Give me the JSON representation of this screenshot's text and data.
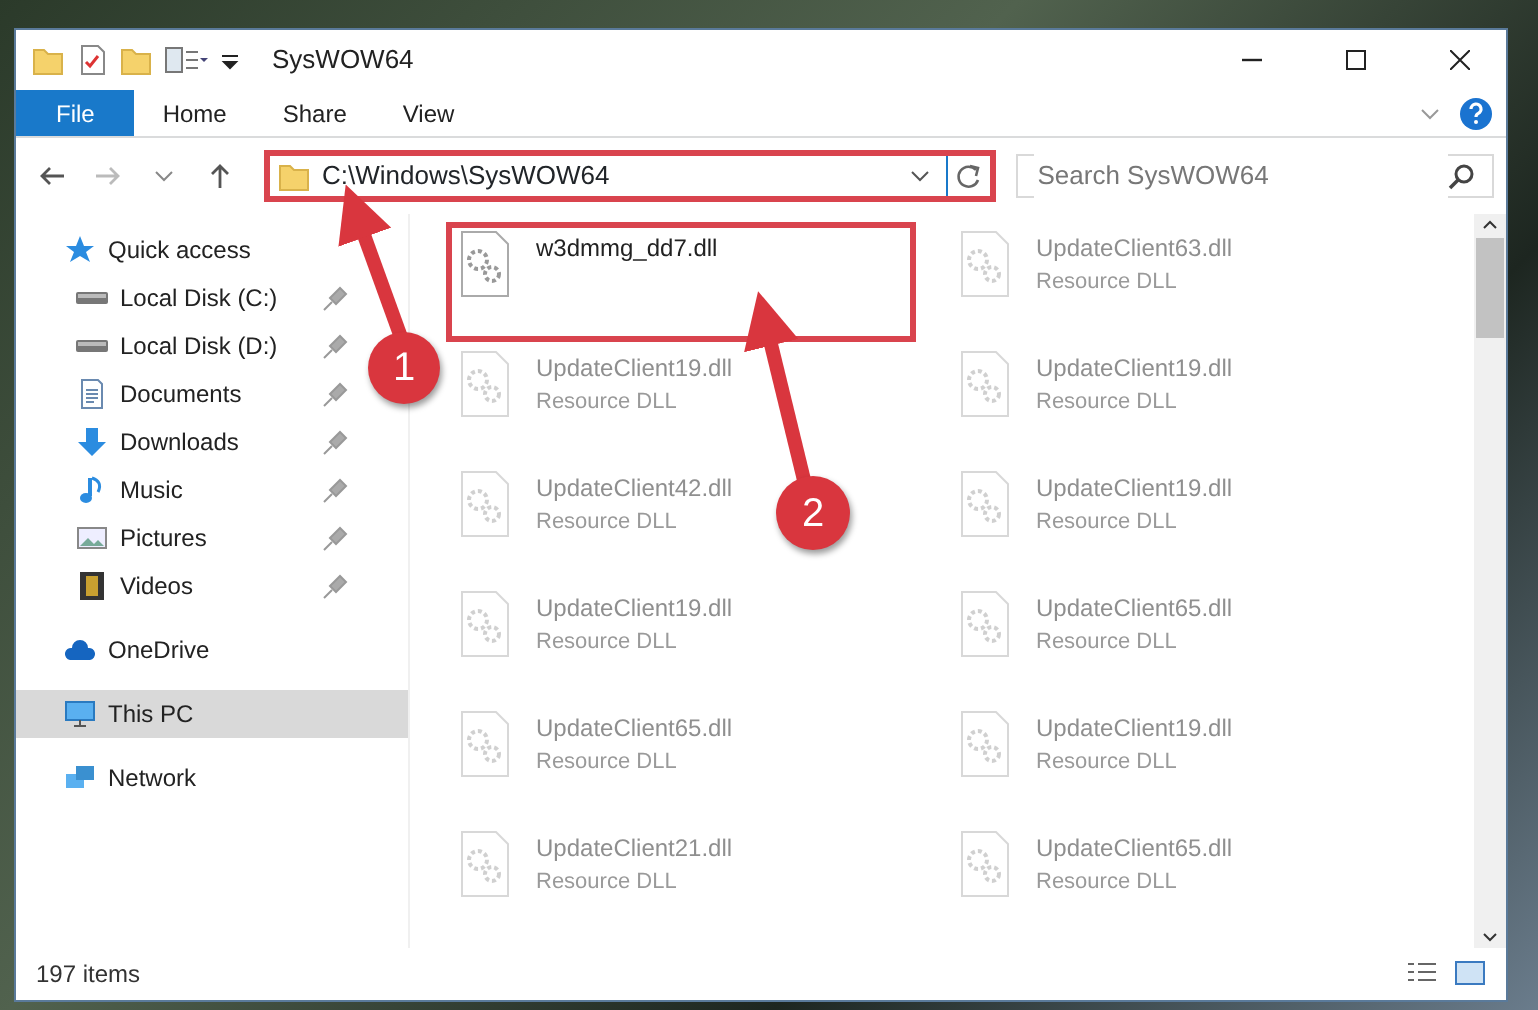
{
  "window": {
    "title": "SysWOW64"
  },
  "ribbon_tabs": [
    {
      "label": "File",
      "selected": true
    },
    {
      "label": "Home",
      "selected": false
    },
    {
      "label": "Share",
      "selected": false
    },
    {
      "label": "View",
      "selected": false
    }
  ],
  "address_bar": {
    "path": "C:\\Windows\\SysWOW64",
    "highlighted": true
  },
  "search": {
    "placeholder": "Search SysWOW64"
  },
  "sidebar": {
    "items": [
      {
        "label": "Quick access",
        "selected": false,
        "children": [
          {
            "label": "Local Disk (C:)",
            "pinned": true,
            "selected": false
          },
          {
            "label": "Local Disk (D:)",
            "pinned": true,
            "selected": false
          },
          {
            "label": "Documents",
            "pinned": true,
            "selected": false
          },
          {
            "label": "Downloads",
            "pinned": true,
            "selected": false
          },
          {
            "label": "Music",
            "pinned": true,
            "selected": false
          },
          {
            "label": "Pictures",
            "pinned": true,
            "selected": false
          },
          {
            "label": "Videos",
            "pinned": true,
            "selected": false
          }
        ]
      },
      {
        "label": "OneDrive",
        "selected": false
      },
      {
        "label": "This PC",
        "selected": true
      },
      {
        "label": "Network",
        "selected": false
      }
    ]
  },
  "files": [
    {
      "name": "w3dmmg_dd7.dll",
      "faded": false,
      "highlighted": true
    },
    {
      "name": "UpdateClient63.dll",
      "type": "Resource DLL",
      "faded": true,
      "highlighted": false
    },
    {
      "name": "UpdateClient19.dll",
      "type": "Resource DLL",
      "faded": true,
      "highlighted": false
    },
    {
      "name": "UpdateClient19.dll",
      "type": "Resource DLL",
      "faded": true,
      "highlighted": false
    },
    {
      "name": "UpdateClient42.dll",
      "type": "Resource DLL",
      "faded": true,
      "highlighted": false
    },
    {
      "name": "UpdateClient19.dll",
      "type": "Resource DLL",
      "faded": true,
      "highlighted": false
    },
    {
      "name": "UpdateClient19.dll",
      "type": "Resource DLL",
      "faded": true,
      "highlighted": false
    },
    {
      "name": "UpdateClient65.dll",
      "type": "Resource DLL",
      "faded": true,
      "highlighted": false
    },
    {
      "name": "UpdateClient65.dll",
      "type": "Resource DLL",
      "faded": true,
      "highlighted": false
    },
    {
      "name": "UpdateClient19.dll",
      "type": "Resource DLL",
      "faded": true,
      "highlighted": false
    },
    {
      "name": "UpdateClient21.dll",
      "type": "Resource DLL",
      "faded": true,
      "highlighted": false
    },
    {
      "name": "UpdateClient65.dll",
      "type": "Resource DLL",
      "faded": true,
      "highlighted": false
    }
  ],
  "annotations": [
    {
      "number": "1"
    },
    {
      "number": "2"
    }
  ],
  "status_bar": {
    "count": "197 items"
  }
}
